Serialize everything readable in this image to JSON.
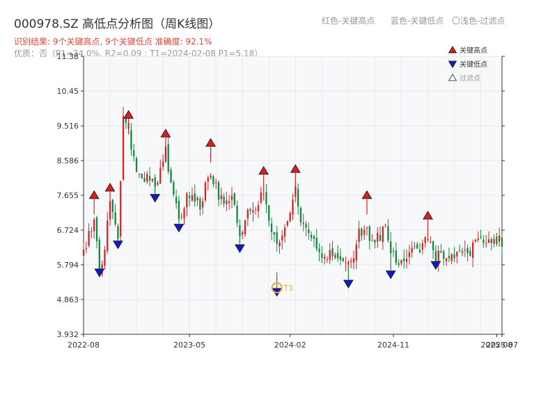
{
  "header": {
    "title": "000978.SZ 高低点分析图（周K线图）",
    "result_text": "识别结果: 9个关键高点, 9个关键低点  准确度: 92.1%",
    "quality_text": "优质：否（P1=34.0%, R2=0.09 ; T1=2024-02-08 P1=5.18）"
  },
  "top_legend": {
    "red": "红色-关键高点",
    "blue": "蓝色-关键低点",
    "light": "〇浅色-过滤点"
  },
  "colors": {
    "up": "#d12525",
    "down": "#0f8a3c",
    "high_marker": "#e31a1c",
    "low_marker": "#1414d6",
    "t1": "#f5a623",
    "grid": "#e6e9ee",
    "plot_bg": "#f7f8fa"
  },
  "chart_data": {
    "type": "candlestick",
    "title": "000978.SZ 高低点分析图（周K线图）",
    "y_ticks": [
      "3.932",
      "4.863",
      "5.794",
      "6.724",
      "7.655",
      "8.586",
      "9.516",
      "10.45",
      "11.38"
    ],
    "ylim": [
      3.932,
      11.38
    ],
    "x_ticks": [
      "2022-08",
      "2023-05",
      "2024-02",
      "2024-11",
      "2025-08",
      "2025-07"
    ],
    "x_range_weeks": 158,
    "legend": {
      "position": "top-right",
      "entries": [
        {
          "label": "关键高点",
          "symbol": "triangle-up",
          "color": "#e31a1c"
        },
        {
          "label": "关键低点",
          "symbol": "triangle-down",
          "color": "#1414d6"
        },
        {
          "label": "过滤点",
          "symbol": "triangle-up-outline",
          "color": "#ffffff"
        }
      ]
    },
    "key_highs": [
      {
        "week": 4,
        "value": 7.55
      },
      {
        "week": 10,
        "value": 7.75
      },
      {
        "week": 17,
        "value": 9.7
      },
      {
        "week": 31,
        "value": 9.2
      },
      {
        "week": 48,
        "value": 8.95
      },
      {
        "week": 68,
        "value": 8.2
      },
      {
        "week": 80,
        "value": 8.25
      },
      {
        "week": 107,
        "value": 7.55
      },
      {
        "week": 130,
        "value": 7.0
      }
    ],
    "key_lows": [
      {
        "week": 6,
        "value": 5.7
      },
      {
        "week": 13,
        "value": 6.45
      },
      {
        "week": 27,
        "value": 7.7
      },
      {
        "week": 36,
        "value": 6.9
      },
      {
        "week": 59,
        "value": 6.35
      },
      {
        "week": 73,
        "value": 5.18
      },
      {
        "week": 100,
        "value": 5.4
      },
      {
        "week": 116,
        "value": 5.65
      },
      {
        "week": 133,
        "value": 5.9
      }
    ],
    "t1": {
      "label": "T1",
      "week": 73,
      "value": 5.18
    },
    "price_path": [
      [
        0,
        6.1
      ],
      [
        4,
        7.1
      ],
      [
        6,
        5.75
      ],
      [
        8,
        6.2
      ],
      [
        10,
        7.6
      ],
      [
        13,
        6.5
      ],
      [
        15,
        9.9
      ],
      [
        17,
        9.3
      ],
      [
        20,
        8.2
      ],
      [
        24,
        8.1
      ],
      [
        27,
        7.85
      ],
      [
        31,
        8.8
      ],
      [
        36,
        7.0
      ],
      [
        40,
        7.7
      ],
      [
        44,
        7.4
      ],
      [
        48,
        8.3
      ],
      [
        52,
        7.5
      ],
      [
        56,
        7.6
      ],
      [
        59,
        6.5
      ],
      [
        63,
        7.3
      ],
      [
        66,
        7.4
      ],
      [
        68,
        7.8
      ],
      [
        71,
        6.7
      ],
      [
        73,
        6.2
      ],
      [
        76,
        6.7
      ],
      [
        80,
        7.9
      ],
      [
        82,
        7.0
      ],
      [
        86,
        6.6
      ],
      [
        90,
        6.1
      ],
      [
        94,
        6.0
      ],
      [
        97,
        5.9
      ],
      [
        100,
        5.7
      ],
      [
        102,
        6.1
      ],
      [
        104,
        6.6
      ],
      [
        107,
        6.7
      ],
      [
        110,
        6.4
      ],
      [
        114,
        6.8
      ],
      [
        116,
        6.1
      ],
      [
        118,
        5.9
      ],
      [
        122,
        6.0
      ],
      [
        126,
        6.2
      ],
      [
        130,
        6.6
      ],
      [
        133,
        6.0
      ],
      [
        136,
        6.0
      ],
      [
        140,
        6.0
      ],
      [
        144,
        6.1
      ],
      [
        148,
        6.3
      ],
      [
        152,
        6.5
      ],
      [
        155,
        6.55
      ],
      [
        158,
        6.4
      ]
    ]
  }
}
